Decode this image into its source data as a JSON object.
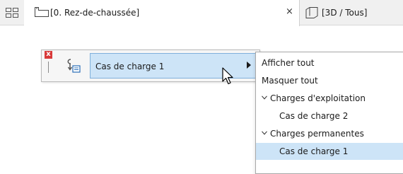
{
  "tabs": {
    "active_label": "[0. Rez-de-chaussée]",
    "close_glyph": "×",
    "inactive_label": "[3D / Tous]"
  },
  "palette": {
    "close_glyph": "x",
    "selected_value": "Cas de charge 1"
  },
  "menu": {
    "items": [
      {
        "label": "Afficher tout",
        "kind": "action"
      },
      {
        "label": "Masquer tout",
        "kind": "action"
      },
      {
        "label": "Charges d'exploitation",
        "kind": "group",
        "expanded": true
      },
      {
        "label": "Cas de charge 2",
        "kind": "child"
      },
      {
        "label": "Charges permanentes",
        "kind": "group",
        "expanded": true
      },
      {
        "label": "Cas de charge 1",
        "kind": "child",
        "selected": true
      }
    ]
  },
  "colors": {
    "selection": "#cde4f7",
    "selection_border": "#7fb0db",
    "close_red": "#d83a3a"
  },
  "icons": [
    "view-grid-icon",
    "floor-plan-icon",
    "3d-view-icon",
    "load-case-icon",
    "submenu-arrow-icon",
    "chevron-down-icon",
    "mouse-pointer-icon"
  ]
}
